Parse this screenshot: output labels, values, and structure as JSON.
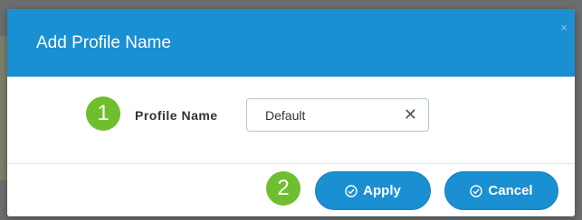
{
  "dialog": {
    "title": "Add Profile Name",
    "close_glyph": "×"
  },
  "form": {
    "step_1": "1",
    "profile_name_label": "Profile Name",
    "profile_name_value": "Default",
    "clear_glyph": "✕"
  },
  "footer": {
    "step_2": "2",
    "apply_label": "Apply",
    "cancel_label": "Cancel"
  },
  "icons": {
    "close": "close-icon",
    "clear": "clear-icon",
    "apply": "check-circle-icon",
    "cancel": "check-circle-icon"
  },
  "colors": {
    "header_blue": "#1a8fd1",
    "step_badge_green": "#6ebe2e",
    "button_blue": "#1a8fd1"
  }
}
